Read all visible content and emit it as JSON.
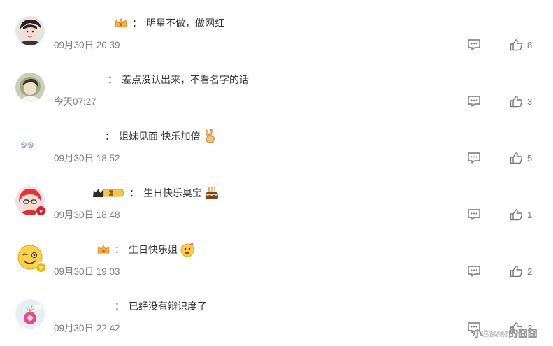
{
  "comments": [
    {
      "text": "明星不做，做网红",
      "time": "09月30日 20:39",
      "likes": "8",
      "colon": "："
    },
    {
      "text": "差点没认出来，不看名字的话",
      "time": "今天07:27",
      "likes": "3",
      "colon": "："
    },
    {
      "text": "姐妹见面 快乐加倍",
      "time": "09月30日 18:52",
      "likes": "5",
      "colon": "："
    },
    {
      "text": "生日快乐臭宝",
      "time": "09月30日 18:48",
      "likes": "1",
      "colon": "："
    },
    {
      "text": "生日快乐姐",
      "time": "09月30日 19:03",
      "likes": "2",
      "colon": "："
    },
    {
      "text": "已经没有辩识度了",
      "time": "09月30日 22:42",
      "likes": "3",
      "colon": "："
    }
  ],
  "watermark": "小Sever的囧囧",
  "colors": {
    "accent": "#eb7350",
    "meta": "#808080",
    "verified_red": "#e6162d",
    "verified_yellow": "#f6b600"
  },
  "icons": {
    "reply": "comment-icon",
    "like": "thumbs-up-icon"
  }
}
